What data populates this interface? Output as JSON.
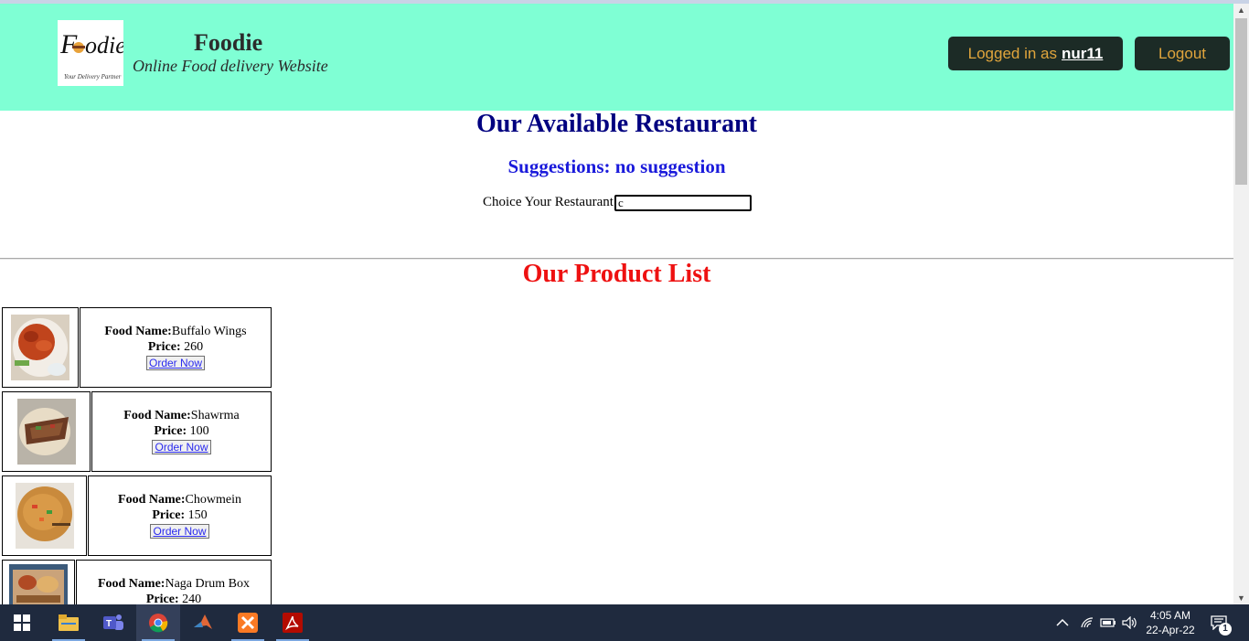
{
  "header": {
    "logo_text": "Foodie",
    "logo_tagline": "Your Delivery Partner",
    "title": "Foodie",
    "subtitle": "Online Food delivery Website",
    "logged_in_prefix": "Logged in as",
    "username": "nur11",
    "logout_label": "Logout"
  },
  "restaurant": {
    "heading": "Our Available Restaurant",
    "suggestions": "Suggestions: no suggestion",
    "choice_label": "Choice Your Restaurant:",
    "choice_value": "c"
  },
  "products": {
    "heading": "Our Product List",
    "name_label": "Food Name:",
    "price_label": "Price:",
    "order_label": "Order Now",
    "items": [
      {
        "name": "Buffalo Wings",
        "price": "260"
      },
      {
        "name": "Shawrma",
        "price": "100"
      },
      {
        "name": "Chowmein",
        "price": "150"
      },
      {
        "name": "Naga Drum Box",
        "price": "240"
      }
    ]
  },
  "taskbar": {
    "time": "4:05 AM",
    "date": "22-Apr-22",
    "notification_count": "1",
    "apps": [
      "windows-start",
      "file-explorer",
      "teams",
      "chrome",
      "matlab",
      "xampp",
      "acrobat"
    ]
  },
  "colors": {
    "header_bg": "#7fffd4",
    "button_bg": "#1c2b26",
    "button_text": "#e0a53c",
    "restaurant_heading": "#000080",
    "suggestion_text": "#1a1adb",
    "product_heading": "#ee1111",
    "taskbar_bg": "#1f2a3e"
  }
}
